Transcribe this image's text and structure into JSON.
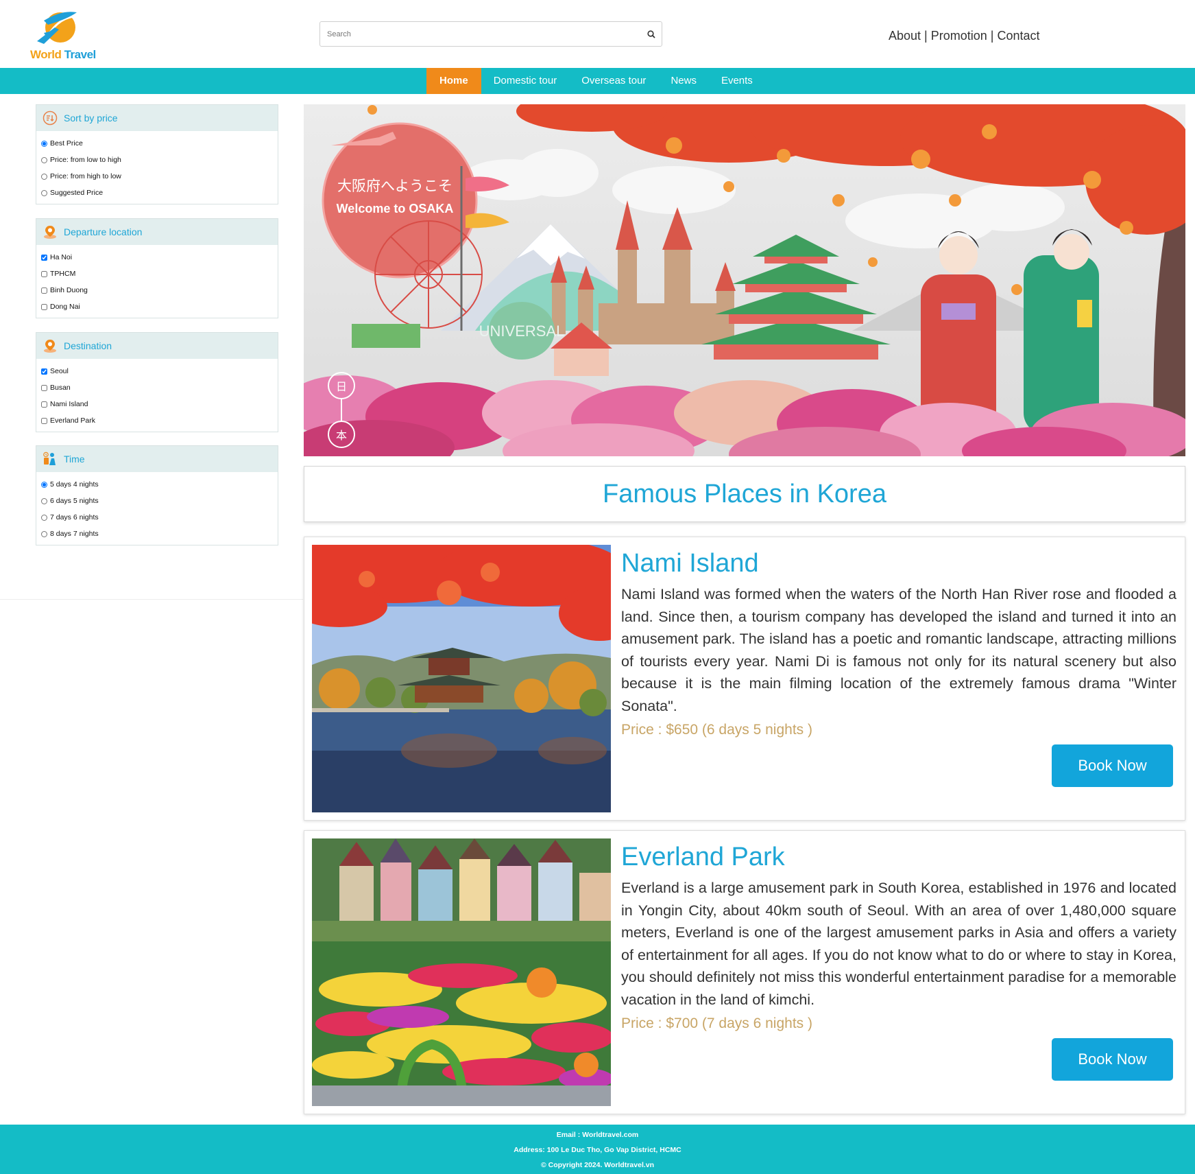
{
  "header": {
    "logo_word1": "World",
    "logo_word2": "Travel",
    "search_placeholder": "Search",
    "links": [
      "About",
      "Promotion",
      "Contact"
    ],
    "separator": " | "
  },
  "nav": {
    "items": [
      "Home",
      "Domestic tour",
      "Overseas tour",
      "News",
      "Events"
    ],
    "active": "Home"
  },
  "sidebar": {
    "sort": {
      "title": "Sort by price",
      "options": [
        "Best Price",
        "Price: from low to high",
        "Price: from high to low",
        "Suggested Price"
      ],
      "selected": "Best Price"
    },
    "departure": {
      "title": "Departure location",
      "options": [
        "Ha Noi",
        "TPHCM",
        "Binh Duong",
        "Dong Nai"
      ],
      "checked": [
        "Ha Noi"
      ]
    },
    "destination": {
      "title": "Destination",
      "options": [
        "Seoul",
        "Busan",
        "Nami Island",
        "Everland Park"
      ],
      "checked": [
        "Seoul"
      ]
    },
    "time": {
      "title": "Time",
      "options": [
        "5 days 4 nights",
        "6 days 5 nights",
        "7 days 6 nights",
        "8 days 7 nights"
      ],
      "selected": "5 days 4 nights"
    }
  },
  "banner": {
    "jp_text": "大阪府へようこそ",
    "welcome": "Welcome to OSAKA",
    "sign": "UNIVERSAL",
    "lantern1": "日",
    "lantern2": "本"
  },
  "main": {
    "section_title": "Famous Places in Korea",
    "places": [
      {
        "name": "Nami Island",
        "description": "Nami Island was formed when the waters of the North Han River rose and flooded a land. Since then, a tourism company has developed the island and turned it into an amusement park. The island has a poetic and romantic landscape, attracting millions of tourists every year. Nami Di is famous not only for its natural scenery but also because it is the main filming location of the extremely famous drama \"Winter Sonata\".",
        "price": "Price : $650 (6 days 5 nights )",
        "button": "Book Now"
      },
      {
        "name": "Everland Park",
        "description": "Everland is a large amusement park in South Korea, established in 1976 and located in Yongin City, about 40km south of Seoul. With an area of over 1,480,000 square meters, Everland is one of the largest amusement parks in Asia and offers a variety of entertainment for all ages. If you do not know what to do or where to stay in Korea, you should definitely not miss this wonderful entertainment paradise for a memorable vacation in the land of kimchi.",
        "price": "Price : $700 (7 days 6 nights )",
        "button": "Book Now"
      }
    ]
  },
  "footer": {
    "email": "Email : Worldtravel.com",
    "address": "Address: 100 Le Duc Tho, Go Vap District, HCMC",
    "copyright": "© Copyright 2024. Worldtravel.vn"
  },
  "colors": {
    "teal": "#14bcc6",
    "orange": "#f08a1a",
    "blue": "#1fa6d6",
    "gold": "#c8a566",
    "button": "#12a5db"
  }
}
